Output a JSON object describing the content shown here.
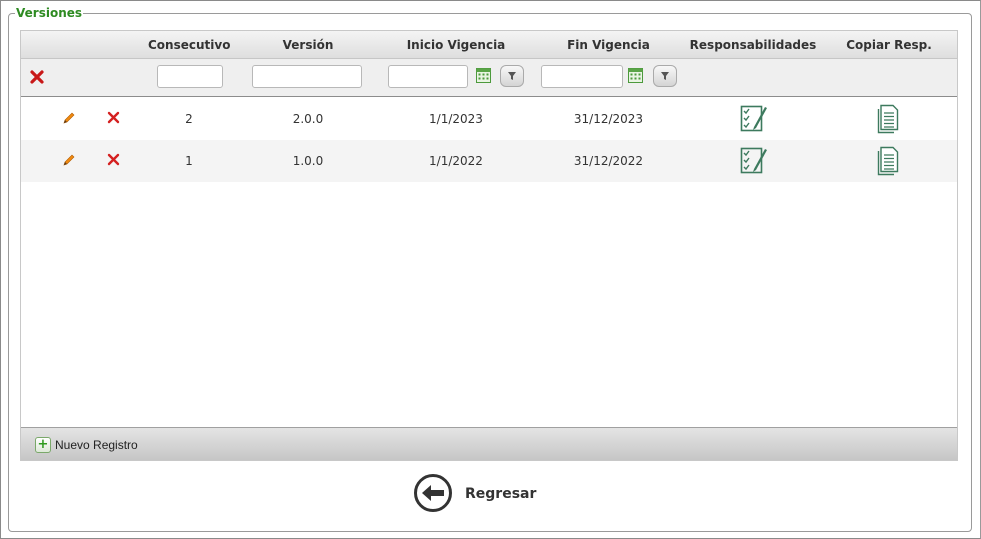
{
  "panel": {
    "title": "Versiones"
  },
  "grid": {
    "columns": [
      {
        "key": "consecutivo",
        "label": "Consecutivo"
      },
      {
        "key": "version",
        "label": "Versión"
      },
      {
        "key": "inicio_vigencia",
        "label": "Inicio Vigencia"
      },
      {
        "key": "fin_vigencia",
        "label": "Fin Vigencia"
      },
      {
        "key": "responsabilidades",
        "label": "Responsabilidades"
      },
      {
        "key": "copiar_resp",
        "label": "Copiar Resp."
      }
    ],
    "filters": {
      "consecutivo": "",
      "version": "",
      "inicio_vigencia": "",
      "fin_vigencia": ""
    },
    "rows": [
      {
        "consecutivo": "2",
        "version": "2.0.0",
        "inicio_vigencia": "1/1/2023",
        "fin_vigencia": "31/12/2023"
      },
      {
        "consecutivo": "1",
        "version": "1.0.0",
        "inicio_vigencia": "1/1/2022",
        "fin_vigencia": "31/12/2022"
      }
    ],
    "footer": {
      "new_record_label": "Nuevo Registro"
    }
  },
  "actions": {
    "back_label": "Regresar"
  },
  "icons": {
    "edit": "pencil-icon",
    "delete": "delete-x-icon",
    "clear_filters": "clear-filters-x-icon",
    "calendar": "calendar-icon",
    "filter": "funnel-icon",
    "responsibilities": "checklist-icon",
    "copy": "document-copy-icon",
    "add": "plus-icon",
    "back": "back-arrow-icon"
  },
  "colors": {
    "accent_green": "#2e8b22",
    "delete_red": "#d42020",
    "edit_orange": "#e07a10",
    "icon_teal": "#3d7a5e"
  }
}
